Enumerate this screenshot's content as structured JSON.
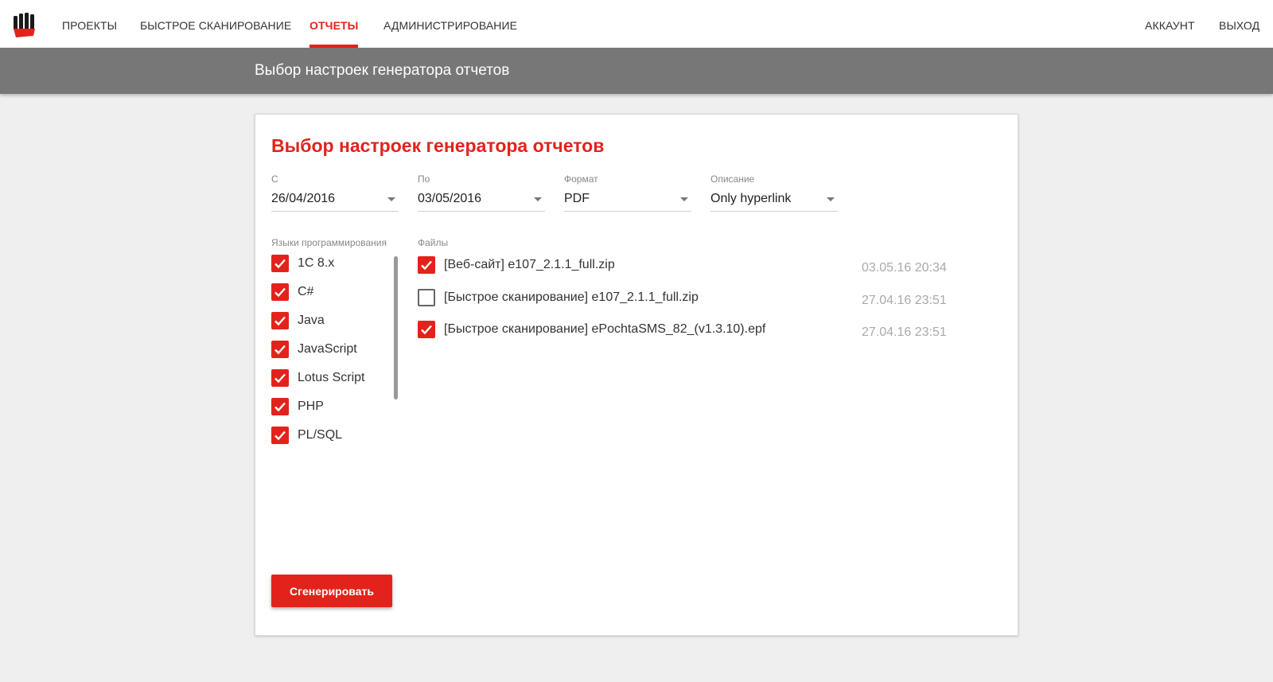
{
  "nav": {
    "items": [
      {
        "label": "ПРОЕКТЫ",
        "active": false
      },
      {
        "label": "БЫСТРОЕ СКАНИРОВАНИЕ",
        "active": false
      },
      {
        "label": "ОТЧЕТЫ",
        "active": true
      },
      {
        "label": "АДМИНИСТРИРОВАНИЕ",
        "active": false
      }
    ],
    "account": "АККАУНТ",
    "logout": "ВЫХОД"
  },
  "subheader": {
    "title": "Выбор настроек генератора отчетов"
  },
  "card": {
    "title": "Выбор настроек генератора отчетов",
    "fields": {
      "from": {
        "label": "С",
        "value": "26/04/2016"
      },
      "to": {
        "label": "По",
        "value": "03/05/2016"
      },
      "format": {
        "label": "Формат",
        "value": "PDF"
      },
      "description": {
        "label": "Описание",
        "value": "Only hyperlink"
      }
    },
    "languages_label": "Языки программирования",
    "languages": [
      {
        "label": "1C 8.x",
        "checked": true
      },
      {
        "label": "C#",
        "checked": true
      },
      {
        "label": "Java",
        "checked": true
      },
      {
        "label": "JavaScript",
        "checked": true
      },
      {
        "label": "Lotus Script",
        "checked": true
      },
      {
        "label": "PHP",
        "checked": true
      },
      {
        "label": "PL/SQL",
        "checked": true
      }
    ],
    "files_label": "Файлы",
    "files": [
      {
        "name": "[Веб-сайт] e107_2.1.1_full.zip",
        "date": "03.05.16 20:34",
        "checked": true
      },
      {
        "name": "[Быстрое сканирование] e107_2.1.1_full.zip",
        "date": "27.04.16 23:51",
        "checked": false
      },
      {
        "name": "[Быстрое сканирование] ePochtaSMS_82_(v1.3.10).epf",
        "date": "27.04.16 23:51",
        "checked": true
      }
    ],
    "generate_label": "Сгенерировать"
  },
  "colors": {
    "accent": "#e3231b",
    "subheader": "#777777",
    "background": "#efefef"
  }
}
